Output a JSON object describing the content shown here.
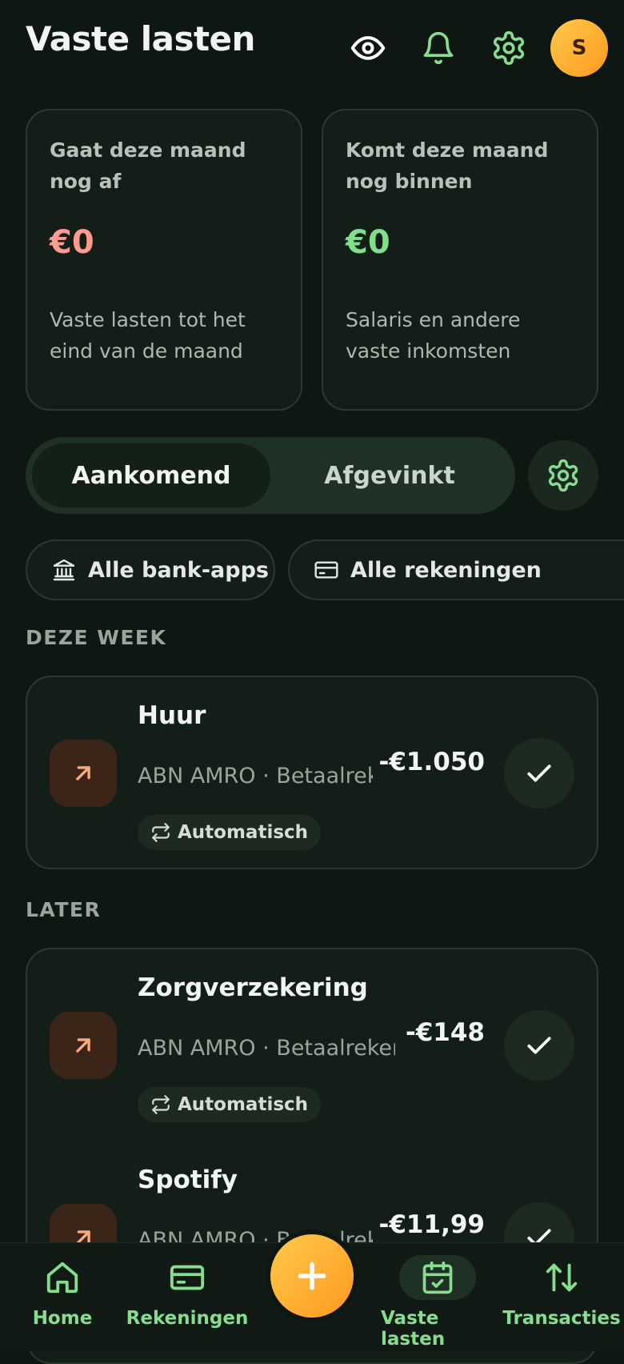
{
  "header": {
    "title": "Vaste lasten",
    "avatar_initial": "S",
    "icons": [
      "eye-icon",
      "bell-icon",
      "gear-icon"
    ]
  },
  "summary": {
    "outgoing": {
      "label": "Gaat deze maand nog af",
      "amount": "€0",
      "amount_color": "#ff9a8e",
      "description": "Vaste lasten tot het eind van de maand"
    },
    "incoming": {
      "label": "Komt deze maand nog binnen",
      "amount": "€0",
      "amount_color": "#7fe08c",
      "description": "Salaris en andere vaste inkomsten"
    }
  },
  "toggle": {
    "active": "Aankomend",
    "inactive": "Afgevinkt"
  },
  "filters": {
    "bank_apps": "Alle bank-apps",
    "accounts": "Alle rekeningen"
  },
  "sections": {
    "this_week": "DEZE WEEK",
    "later": "LATER"
  },
  "items": [
    {
      "name": "Huur",
      "account": "ABN AMRO · Betaalrekening",
      "amount": "-€1.050",
      "badge": "Automatisch"
    },
    {
      "name": "Zorgverzekering",
      "account": "ABN AMRO · Betaalrekening",
      "amount": "-€148",
      "badge": "Automatisch"
    },
    {
      "name": "Spotify",
      "account": "ABN AMRO · Betaalrekening",
      "amount": "-€11,99"
    }
  ],
  "nav": {
    "home": "Home",
    "accounts": "Rekeningen",
    "fixed_costs": "Vaste lasten",
    "transactions": "Transacties"
  },
  "colors": {
    "accent_green": "#86dd8f",
    "accent_orange": "#ffa62b",
    "background": "#0f1712"
  }
}
